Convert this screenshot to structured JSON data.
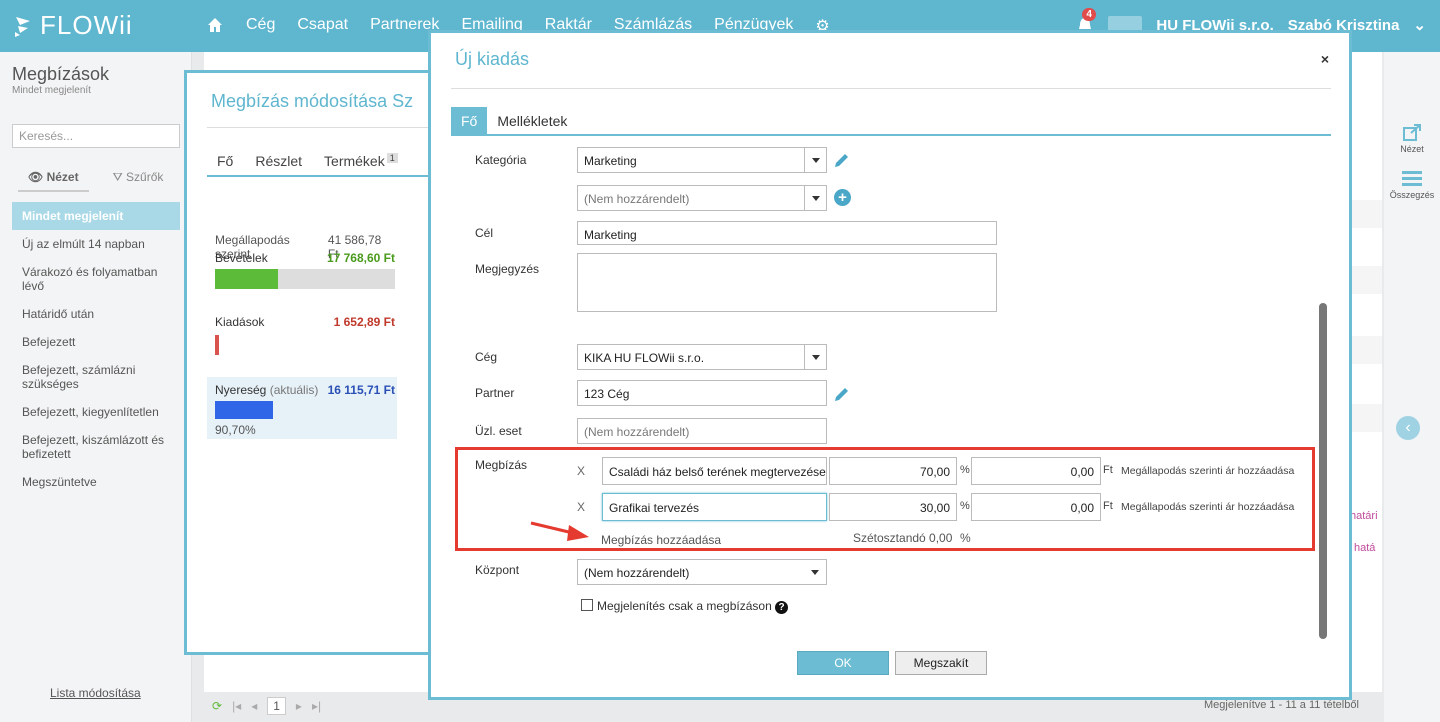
{
  "app": {
    "logo": "FLOWii"
  },
  "nav": [
    "Cég",
    "Csapat",
    "Partnerek",
    "Emailing",
    "Raktár",
    "Számlázás",
    "Pénzügyek"
  ],
  "topright": {
    "notifications": "4",
    "company": "HU FLOWii s.r.o.",
    "user": "Szabó Krisztina"
  },
  "sidebar": {
    "title": "Megbízások",
    "subtitle": "Mindet megjelenít",
    "search_placeholder": "Keresés...",
    "tab_view": "Nézet",
    "tab_filters": "Szűrők",
    "items": [
      {
        "label": "Mindet megjelenít",
        "active": true
      },
      {
        "label": "Új az elmúlt 14 napban"
      },
      {
        "label": "Várakozó és folyamatban lévő"
      },
      {
        "label": "Határidő után"
      },
      {
        "label": "Befejezett"
      },
      {
        "label": "Befejezett, számlázni szükséges"
      },
      {
        "label": "Befejezett, kiegyenlítetlen"
      },
      {
        "label": "Befejezett, kiszámlázott és befizetett"
      },
      {
        "label": "Megszüntetve"
      }
    ],
    "footer": "Lista módosítása"
  },
  "rail": {
    "view": "Nézet",
    "summary": "Összegzés"
  },
  "background": {
    "pink1": "határi",
    "pink2": "hatá",
    "pager_page": "1",
    "pager_info": "Megjelenítve 1 - 11 a 11 tételből"
  },
  "mid_modal": {
    "title": "Megbízás módosítása Sz",
    "tabs": [
      "Fő",
      "Részlet",
      "Termékek"
    ],
    "tab_badge": "1",
    "agreed_label": "Megállapodás szerint",
    "agreed_value": "41 586,78 Ft",
    "income_label": "Bevételek",
    "income_value": "17 768,60 Ft",
    "income_ratio": 0.35,
    "expense_label": "Kiadások",
    "expense_value": "1 652,89 Ft",
    "profit_label": "Nyereség",
    "profit_sub": "(aktuális)",
    "profit_value": "16 115,71 Ft",
    "profit_percent": "90,70%",
    "colors": {
      "income": "#5dbb3a",
      "expense": "#d9534f",
      "profit": "#2f66e8"
    }
  },
  "modal": {
    "title": "Új kiadás",
    "close": "×",
    "tabs": {
      "main": "Fő",
      "attachments": "Mellékletek"
    },
    "category_label": "Kategória",
    "category_value": "Marketing",
    "subcategory_value": "(Nem hozzárendelt)",
    "goal_label": "Cél",
    "goal_value": "Marketing",
    "note_label": "Megjegyzés",
    "note_value": "",
    "company_label": "Cég",
    "company_value": "KIKA HU FLOWii s.r.o.",
    "partner_label": "Partner",
    "partner_value": "123  Cég",
    "case_label": "Üzl. eset",
    "case_placeholder": "(Nem hozzárendelt)",
    "order_label": "Megbízás",
    "orders": [
      {
        "remove": "X",
        "name": "Családi ház belső terének megtervezése",
        "percent": "70,00",
        "pct_sign": "%",
        "amount": "0,00",
        "currency": "Ft",
        "link": "Megállapodás szerinti ár hozzáadása"
      },
      {
        "remove": "X",
        "name": "Grafikai tervezés",
        "percent": "30,00",
        "pct_sign": "%",
        "amount": "0,00",
        "currency": "Ft",
        "link": "Megállapodás szerinti ár hozzáadása"
      }
    ],
    "add_order": "Megbízás hozzáadása",
    "distribute": "Szétosztandó 0,00",
    "distribute_pct": "%",
    "center_label": "Központ",
    "center_value": "(Nem hozzárendelt)",
    "checkbox_label": "Megjelenítés csak a megbízáson",
    "help": "?",
    "ok": "OK",
    "cancel": "Megszakít"
  }
}
